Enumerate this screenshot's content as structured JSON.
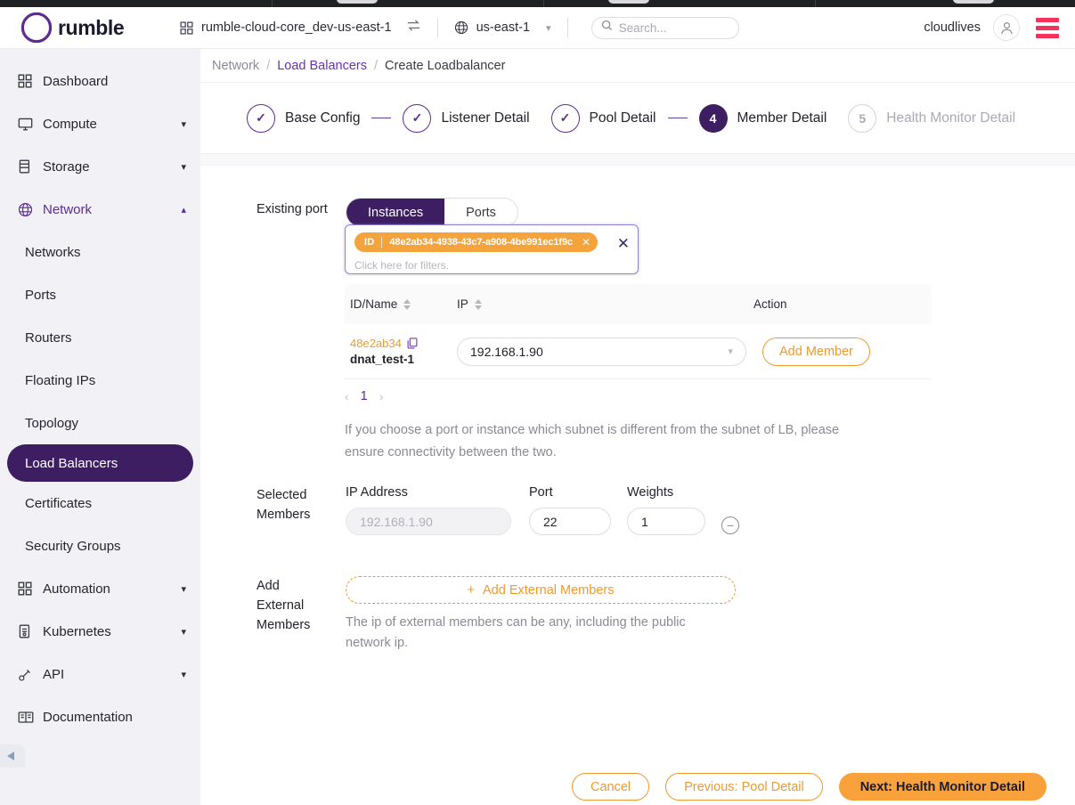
{
  "header": {
    "brand_name": "rumble",
    "brand_logo_icon": "cloud-logo-icon",
    "project_icon": "grid-icon",
    "project_name": "rumble-cloud-core_dev-us-east-1",
    "swap_icon": "swap-arrows-icon",
    "region_icon": "globe-icon",
    "region_name": "us-east-1",
    "region_caret_icon": "chevron-down-icon",
    "search_icon": "search-icon",
    "search_value": "",
    "search_placeholder": "Search...",
    "user_name": "cloudlives",
    "avatar_icon": "user-avatar-icon",
    "menu_icon": "hamburger-menu-icon",
    "menu_color": "#f5325b"
  },
  "sidebar": {
    "items": [
      {
        "label": "Dashboard",
        "icon": "grid-icon",
        "type": "link"
      },
      {
        "label": "Compute",
        "icon": "monitor-icon",
        "type": "group",
        "caret": "chevron-down-icon"
      },
      {
        "label": "Storage",
        "icon": "storage-icon",
        "type": "group",
        "caret": "chevron-down-icon"
      },
      {
        "label": "Network",
        "icon": "globe-icon",
        "type": "group",
        "caret": "chevron-up-icon",
        "active": true
      },
      {
        "label": "Networks",
        "type": "sub"
      },
      {
        "label": "Ports",
        "type": "sub"
      },
      {
        "label": "Routers",
        "type": "sub"
      },
      {
        "label": "Floating IPs",
        "type": "sub"
      },
      {
        "label": "Topology",
        "type": "sub"
      },
      {
        "label": "Load Balancers",
        "type": "sub",
        "selected": true
      },
      {
        "label": "Certificates",
        "type": "sub"
      },
      {
        "label": "Security Groups",
        "type": "sub"
      },
      {
        "label": "Automation",
        "icon": "grid-icon",
        "type": "group",
        "caret": "chevron-down-icon"
      },
      {
        "label": "Kubernetes",
        "icon": "kubernetes-icon",
        "type": "group",
        "caret": "chevron-down-icon"
      },
      {
        "label": "API",
        "icon": "api-icon",
        "type": "group",
        "caret": "chevron-down-icon"
      },
      {
        "label": "Documentation",
        "icon": "book-icon",
        "type": "link"
      }
    ],
    "selected_color": "#3d1e62",
    "active_color": "#5b2d8e"
  },
  "breadcrumb": {
    "root": "Network",
    "sep1": "/",
    "link": "Load Balancers",
    "sep2": "/",
    "current": "Create Loadbalancer"
  },
  "stepper": {
    "steps": [
      {
        "num": "1",
        "label": "Base Config",
        "state": "done",
        "mark": "✓"
      },
      {
        "num": "2",
        "label": "Listener Detail",
        "state": "done",
        "mark": "✓"
      },
      {
        "num": "3",
        "label": "Pool Detail",
        "state": "done",
        "mark": "✓"
      },
      {
        "num": "4",
        "label": "Member Detail",
        "state": "current",
        "mark": "4"
      },
      {
        "num": "5",
        "label": "Health Monitor Detail",
        "state": "pending",
        "mark": "5"
      }
    ]
  },
  "form": {
    "existing_port_label": "Existing port",
    "tabs": [
      {
        "label": "Instances",
        "active": true
      },
      {
        "label": "Ports",
        "active": false
      }
    ],
    "filter": {
      "chip_key": "ID",
      "chip_value": "48e2ab34-4938-43c7-a908-4be991ec1f9c",
      "chip_remove_icon": "chip-close-icon",
      "placeholder": "Click here for filters.",
      "clear_icon": "clear-filters-icon",
      "chip_color": "#f5a33c"
    },
    "table": {
      "columns": [
        {
          "label": "ID/Name",
          "sortable": true
        },
        {
          "label": "IP",
          "sortable": true
        },
        {
          "label": "Action",
          "sortable": false
        }
      ],
      "rows": [
        {
          "id": "48e2ab34",
          "copy_icon": "copy-icon",
          "name": "dnat_test-1",
          "ip_selected": "192.168.1.90",
          "ip_caret_icon": "chevron-down-icon",
          "action_label": "Add Member"
        }
      ]
    },
    "pagination": {
      "prev_icon": "chevron-left-icon",
      "page": "1",
      "next_icon": "chevron-right-icon"
    },
    "hint": "If you choose a port or instance which subnet is different from the subnet of LB, please ensure connectivity between the two.",
    "selected_members": {
      "label": "Selected Members",
      "label_line1": "Selected",
      "label_line2": "Members",
      "col_ip": "IP Address",
      "col_port": "Port",
      "col_weights": "Weights",
      "rows": [
        {
          "ip_value": "192.168.1.90",
          "ip_disabled": true,
          "port_value": "22",
          "weight_value": "1",
          "remove_icon": "minus-circle-icon"
        }
      ]
    },
    "add_external": {
      "label_line1": "Add",
      "label_line2": "External",
      "label_line3": "Members",
      "button_icon": "plus-icon",
      "button_label": "Add External Members",
      "hint": "The ip of external members can be any, including the public network ip."
    }
  },
  "footer": {
    "cancel_label": "Cancel",
    "previous_label": "Previous: Pool Detail",
    "next_label": "Next: Health Monitor Detail",
    "primary_color": "#f9a13a",
    "accent_color": "#f0992e"
  }
}
